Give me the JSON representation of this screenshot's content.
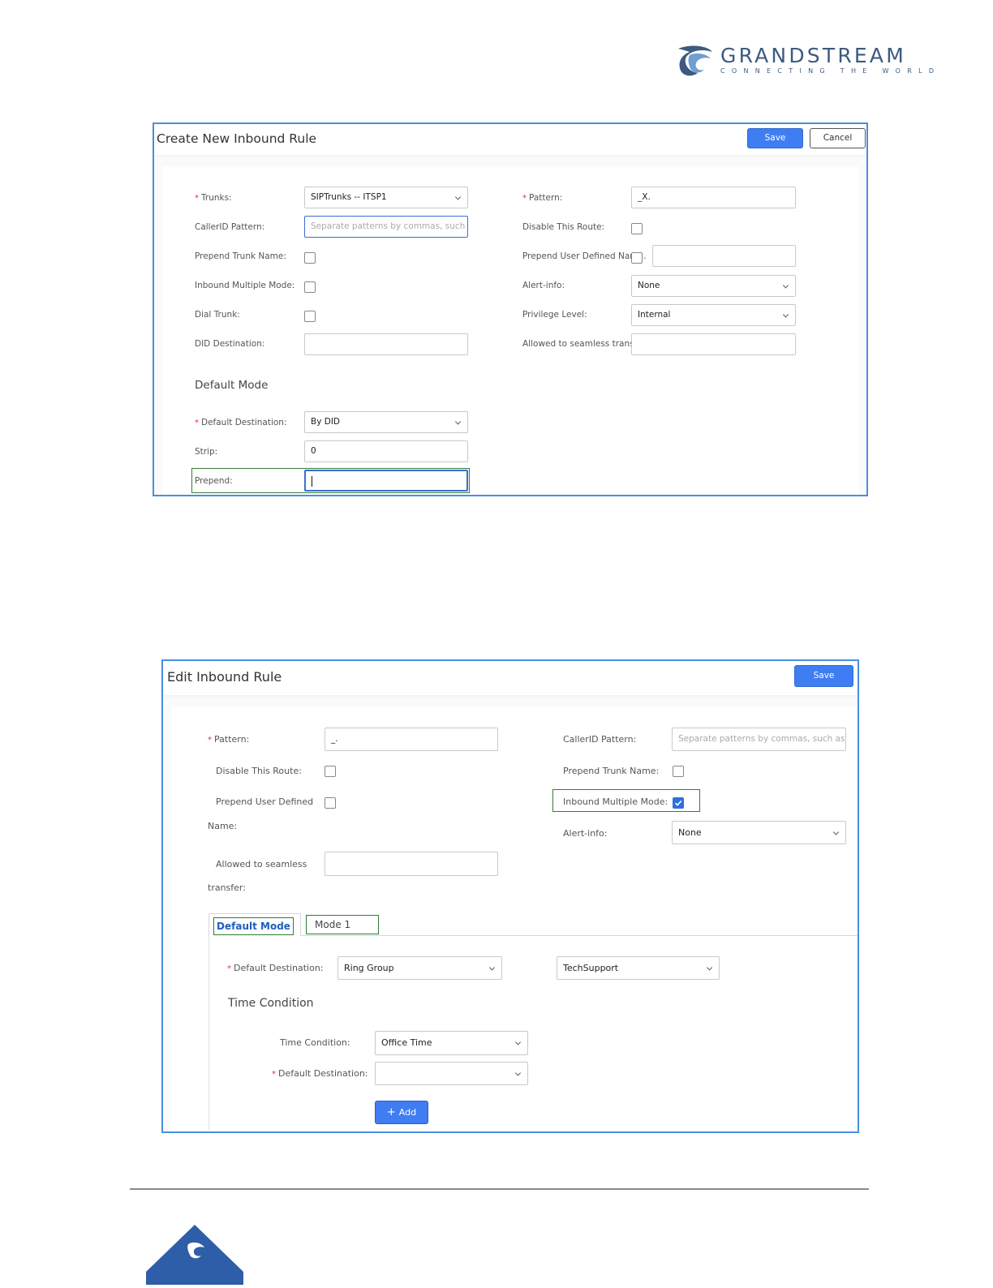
{
  "brand": {
    "name": "GRANDSTREAM",
    "tagline": "CONNECTING THE WORLD",
    "colors": {
      "primary": "#3d5a80",
      "accent": "#4a8fe0"
    }
  },
  "create_rule": {
    "title": "Create New Inbound Rule",
    "save_label": "Save",
    "cancel_label": "Cancel",
    "trunks": {
      "label": "Trunks:",
      "value": "SIPTrunks -- ITSP1"
    },
    "callerid_pattern": {
      "label": "CallerID Pattern:",
      "placeholder": "Separate patterns by commas, such as \"_..."
    },
    "prepend_trunk_name": {
      "label": "Prepend Trunk Name:",
      "checked": false
    },
    "inbound_multiple_mode": {
      "label": "Inbound Multiple Mode:",
      "checked": false
    },
    "dial_trunk": {
      "label": "Dial Trunk:",
      "checked": false
    },
    "did_destination": {
      "label": "DID Destination:",
      "value": ""
    },
    "pattern": {
      "label": "Pattern:",
      "value": "_X."
    },
    "disable_route": {
      "label": "Disable This Route:",
      "checked": false
    },
    "prepend_user_defined": {
      "label": "Prepend User Defined Nam...",
      "checked": false,
      "value": ""
    },
    "alert_info": {
      "label": "Alert-info:",
      "value": "None"
    },
    "privilege_level": {
      "label": "Privilege Level:",
      "value": "Internal"
    },
    "seamless_transfer": {
      "label": "Allowed to seamless transfe...",
      "value": ""
    },
    "default_mode_title": "Default Mode",
    "default_destination": {
      "label": "Default Destination:",
      "value": "By DID"
    },
    "strip": {
      "label": "Strip:",
      "value": "0"
    },
    "prepend": {
      "label": "Prepend:",
      "value": ""
    }
  },
  "edit_rule": {
    "title": "Edit Inbound Rule",
    "save_label": "Save",
    "pattern": {
      "label": "Pattern:",
      "value": "_."
    },
    "disable_route": {
      "label": "Disable This Route:",
      "checked": false
    },
    "prepend_user_defined": {
      "label_line1": "Prepend User Defined",
      "label_line2": "Name:",
      "checked": false
    },
    "seamless_transfer": {
      "label_line1": "Allowed to seamless",
      "label_line2": "transfer:",
      "value": ""
    },
    "callerid_pattern": {
      "label": "CallerID Pattern:",
      "placeholder": "Separate patterns by commas, such as \"_..."
    },
    "prepend_trunk_name": {
      "label": "Prepend Trunk Name:",
      "checked": false
    },
    "inbound_multiple_mode": {
      "label": "Inbound Multiple Mode:",
      "checked": true
    },
    "alert_info": {
      "label": "Alert-info:",
      "value": "None"
    },
    "tabs": [
      {
        "label": "Default Mode",
        "active": true
      },
      {
        "label": "Mode 1",
        "active": false
      }
    ],
    "default_destination": {
      "label": "Default Destination:",
      "value": "Ring Group",
      "target": "TechSupport"
    },
    "time_condition_title": "Time Condition",
    "time_condition": {
      "label": "Time Condition:",
      "value": "Office Time"
    },
    "tc_default_destination": {
      "label": "Default Destination:",
      "value": ""
    },
    "add_label": "Add"
  }
}
